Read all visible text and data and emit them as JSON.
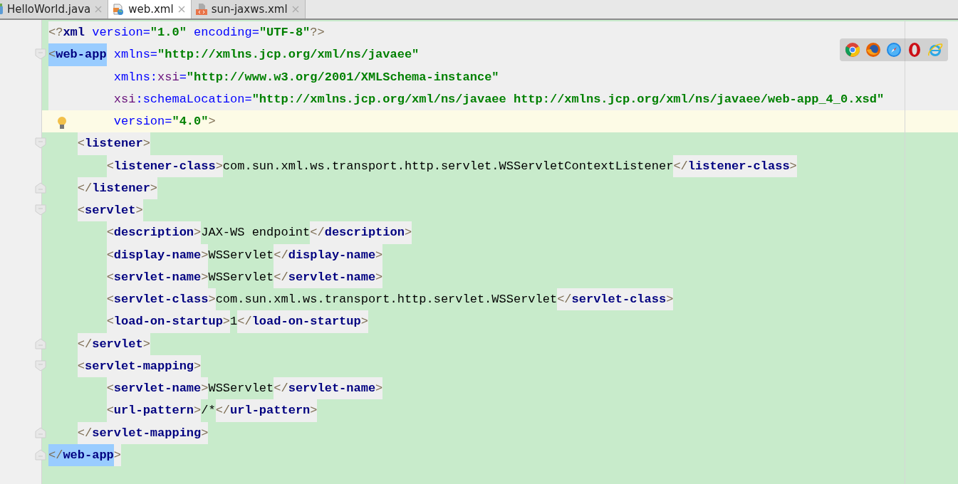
{
  "tabs": [
    {
      "label": "HelloWorld.java",
      "kind": "java",
      "selected": false
    },
    {
      "label": "web.xml",
      "kind": "web",
      "selected": true
    },
    {
      "label": "sun-jaxws.xml",
      "kind": "xml",
      "selected": false
    }
  ],
  "lines": [
    {
      "kind": "plain",
      "current": false,
      "matched": false,
      "tokens": [
        {
          "kind": "bracket",
          "text": "<?"
        },
        {
          "kind": "tag",
          "text": "xml"
        },
        {
          "kind": "attribute",
          "text": " version="
        },
        {
          "kind": "value",
          "text": "\"1.0\""
        },
        {
          "kind": "attribute",
          "text": " encoding="
        },
        {
          "kind": "value",
          "text": "\"UTF-8\""
        },
        {
          "kind": "bracket",
          "text": "?>"
        }
      ]
    },
    {
      "kind": "plain",
      "current": false,
      "matched": true,
      "fold": {
        "kind": "start"
      },
      "tokens": [
        {
          "kind": "bracket",
          "text": "<"
        },
        {
          "kind": "tag",
          "text": "web-app"
        },
        {
          "kind": "attribute",
          "text": " xmlns="
        },
        {
          "kind": "value",
          "text": "\"http://xmlns.jcp.org/xml/ns/javaee\""
        }
      ]
    },
    {
      "kind": "plain",
      "current": false,
      "matched": false,
      "tokens": [
        {
          "kind": "attribute",
          "text": "         xmlns:"
        },
        {
          "kind": "namespace",
          "text": "xsi"
        },
        {
          "kind": "attribute",
          "text": "="
        },
        {
          "kind": "value",
          "text": "\"http://www.w3.org/2001/XMLSchema-instance\""
        }
      ]
    },
    {
      "kind": "plain",
      "current": false,
      "matched": false,
      "tokens": [
        {
          "kind": "namespace",
          "text": "         xsi"
        },
        {
          "kind": "attribute",
          "text": ":schemaLocation="
        },
        {
          "kind": "value",
          "text": "\"http://xmlns.jcp.org/xml/ns/javaee http://xmlns.jcp.org/xml/ns/javaee/web-app_4_0.xsd\""
        }
      ]
    },
    {
      "kind": "plain",
      "current": true,
      "matched": false,
      "bulb": true,
      "tokens": [
        {
          "kind": "attribute",
          "text": "         version="
        },
        {
          "kind": "value",
          "text": "\"4.0\""
        },
        {
          "kind": "bracket",
          "text": ">"
        }
      ]
    },
    {
      "kind": "added",
      "current": false,
      "matched": false,
      "fold": {
        "kind": "start"
      },
      "tokens": [
        {
          "kind": "bracket",
          "text": "    <"
        },
        {
          "kind": "tag",
          "text": "listener"
        },
        {
          "kind": "bracket",
          "text": ">"
        }
      ]
    },
    {
      "kind": "added",
      "current": false,
      "matched": false,
      "tokens": [
        {
          "kind": "bracket",
          "text": "        <"
        },
        {
          "kind": "tag",
          "text": "listener-class"
        },
        {
          "kind": "bracket",
          "text": ">"
        },
        {
          "kind": "text",
          "text": "com.sun.xml.ws.transport.http.servlet.WSServletContextListener"
        },
        {
          "kind": "bracket",
          "text": "</"
        },
        {
          "kind": "tag",
          "text": "listener-class"
        },
        {
          "kind": "bracket",
          "text": ">"
        }
      ]
    },
    {
      "kind": "added",
      "current": false,
      "matched": false,
      "fold": {
        "kind": "end"
      },
      "tokens": [
        {
          "kind": "bracket",
          "text": "    </"
        },
        {
          "kind": "tag",
          "text": "listener"
        },
        {
          "kind": "bracket",
          "text": ">"
        }
      ]
    },
    {
      "kind": "added",
      "current": false,
      "matched": false,
      "fold": {
        "kind": "start"
      },
      "tokens": [
        {
          "kind": "bracket",
          "text": "    <"
        },
        {
          "kind": "tag",
          "text": "servlet"
        },
        {
          "kind": "bracket",
          "text": ">"
        }
      ]
    },
    {
      "kind": "added",
      "current": false,
      "matched": false,
      "tokens": [
        {
          "kind": "bracket",
          "text": "        <"
        },
        {
          "kind": "tag",
          "text": "description"
        },
        {
          "kind": "bracket",
          "text": ">"
        },
        {
          "kind": "text",
          "text": "JAX-WS endpoint"
        },
        {
          "kind": "bracket",
          "text": "</"
        },
        {
          "kind": "tag",
          "text": "description"
        },
        {
          "kind": "bracket",
          "text": ">"
        }
      ]
    },
    {
      "kind": "added",
      "current": false,
      "matched": false,
      "tokens": [
        {
          "kind": "bracket",
          "text": "        <"
        },
        {
          "kind": "tag",
          "text": "display-name"
        },
        {
          "kind": "bracket",
          "text": ">"
        },
        {
          "kind": "text",
          "text": "WSServlet"
        },
        {
          "kind": "bracket",
          "text": "</"
        },
        {
          "kind": "tag",
          "text": "display-name"
        },
        {
          "kind": "bracket",
          "text": ">"
        }
      ]
    },
    {
      "kind": "added",
      "current": false,
      "matched": false,
      "tokens": [
        {
          "kind": "bracket",
          "text": "        <"
        },
        {
          "kind": "tag",
          "text": "servlet-name"
        },
        {
          "kind": "bracket",
          "text": ">"
        },
        {
          "kind": "text",
          "text": "WSServlet"
        },
        {
          "kind": "bracket",
          "text": "</"
        },
        {
          "kind": "tag",
          "text": "servlet-name"
        },
        {
          "kind": "bracket",
          "text": ">"
        }
      ]
    },
    {
      "kind": "added",
      "current": false,
      "matched": false,
      "tokens": [
        {
          "kind": "bracket",
          "text": "        <"
        },
        {
          "kind": "tag",
          "text": "servlet-class"
        },
        {
          "kind": "bracket",
          "text": ">"
        },
        {
          "kind": "text",
          "text": "com.sun.xml.ws.transport.http.servlet.WSServlet"
        },
        {
          "kind": "bracket",
          "text": "</"
        },
        {
          "kind": "tag",
          "text": "servlet-class"
        },
        {
          "kind": "bracket",
          "text": ">"
        }
      ]
    },
    {
      "kind": "added",
      "current": false,
      "matched": false,
      "tokens": [
        {
          "kind": "bracket",
          "text": "        <"
        },
        {
          "kind": "tag",
          "text": "load-on-startup"
        },
        {
          "kind": "bracket",
          "text": ">"
        },
        {
          "kind": "text",
          "text": "1"
        },
        {
          "kind": "bracket",
          "text": "</"
        },
        {
          "kind": "tag",
          "text": "load-on-startup"
        },
        {
          "kind": "bracket",
          "text": ">"
        }
      ]
    },
    {
      "kind": "added",
      "current": false,
      "matched": false,
      "fold": {
        "kind": "end"
      },
      "tokens": [
        {
          "kind": "bracket",
          "text": "    </"
        },
        {
          "kind": "tag",
          "text": "servlet"
        },
        {
          "kind": "bracket",
          "text": ">"
        }
      ]
    },
    {
      "kind": "added",
      "current": false,
      "matched": false,
      "fold": {
        "kind": "start"
      },
      "tokens": [
        {
          "kind": "bracket",
          "text": "    <"
        },
        {
          "kind": "tag",
          "text": "servlet-mapping"
        },
        {
          "kind": "bracket",
          "text": ">"
        }
      ]
    },
    {
      "kind": "added",
      "current": false,
      "matched": false,
      "tokens": [
        {
          "kind": "bracket",
          "text": "        <"
        },
        {
          "kind": "tag",
          "text": "servlet-name"
        },
        {
          "kind": "bracket",
          "text": ">"
        },
        {
          "kind": "text",
          "text": "WSServlet"
        },
        {
          "kind": "bracket",
          "text": "</"
        },
        {
          "kind": "tag",
          "text": "servlet-name"
        },
        {
          "kind": "bracket",
          "text": ">"
        }
      ]
    },
    {
      "kind": "added",
      "current": false,
      "matched": false,
      "tokens": [
        {
          "kind": "bracket",
          "text": "        <"
        },
        {
          "kind": "tag",
          "text": "url-pattern"
        },
        {
          "kind": "bracket",
          "text": ">"
        },
        {
          "kind": "text",
          "text": "/*"
        },
        {
          "kind": "bracket",
          "text": "</"
        },
        {
          "kind": "tag",
          "text": "url-pattern"
        },
        {
          "kind": "bracket",
          "text": ">"
        }
      ]
    },
    {
      "kind": "added",
      "current": false,
      "matched": false,
      "fold": {
        "kind": "end"
      },
      "tokens": [
        {
          "kind": "bracket",
          "text": "    </"
        },
        {
          "kind": "tag",
          "text": "servlet-mapping"
        },
        {
          "kind": "bracket",
          "text": ">"
        }
      ]
    },
    {
      "kind": "added",
      "current": false,
      "matched": true,
      "fold": {
        "kind": "end"
      },
      "tokens": [
        {
          "kind": "bracket",
          "text": "</"
        },
        {
          "kind": "tag",
          "text": "web-app"
        },
        {
          "kind": "bracket",
          "text": ">"
        }
      ]
    }
  ],
  "browsers": [
    {
      "kind": "chrome"
    },
    {
      "kind": "firefox"
    },
    {
      "kind": "safari"
    },
    {
      "kind": "opera"
    },
    {
      "kind": "ie"
    }
  ]
}
